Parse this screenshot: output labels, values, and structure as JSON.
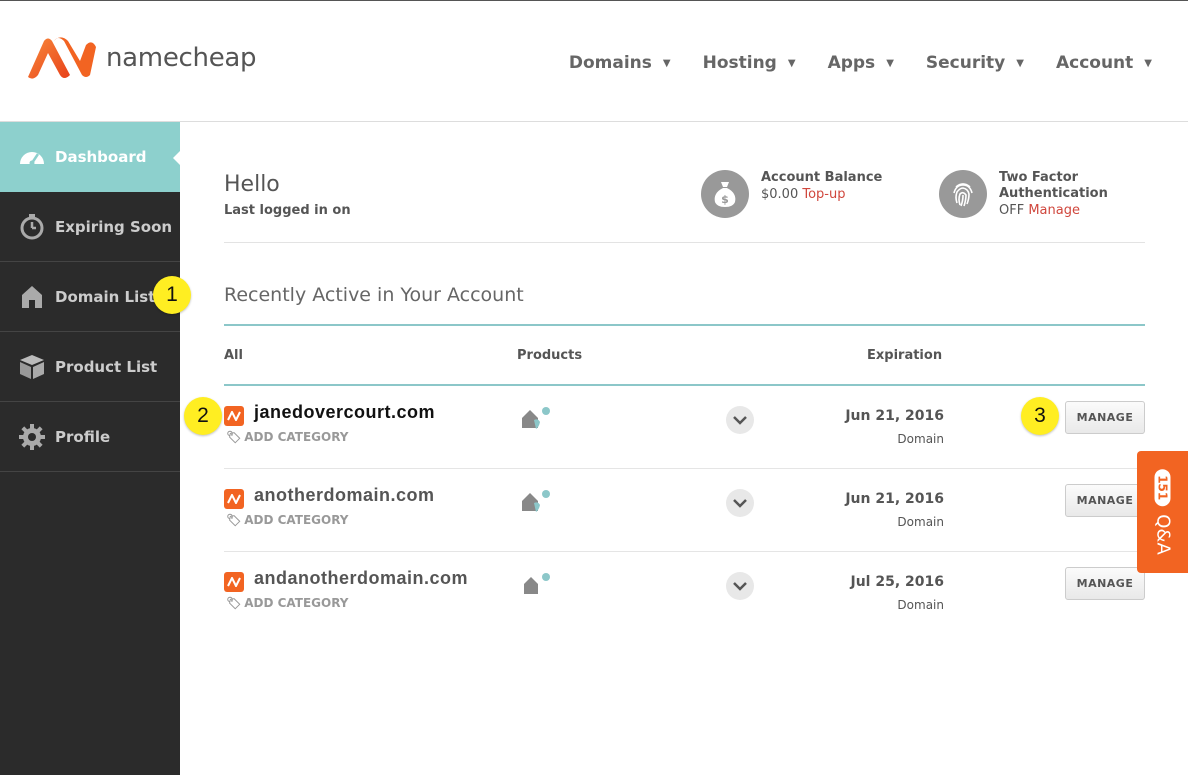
{
  "brand": {
    "name": "namecheap"
  },
  "nav": [
    {
      "label": "Domains"
    },
    {
      "label": "Hosting"
    },
    {
      "label": "Apps"
    },
    {
      "label": "Security"
    },
    {
      "label": "Account"
    }
  ],
  "sidebar": {
    "items": [
      {
        "label": "Dashboard",
        "icon": "speedometer-icon",
        "active": true
      },
      {
        "label": "Expiring Soon",
        "icon": "timer-icon"
      },
      {
        "label": "Domain List",
        "icon": "house-icon"
      },
      {
        "label": "Product List",
        "icon": "box-icon"
      },
      {
        "label": "Profile",
        "icon": "gear-icon"
      }
    ]
  },
  "badges": [
    "1",
    "2",
    "3"
  ],
  "greeting": {
    "hello": "Hello",
    "last_logged": "Last logged in on"
  },
  "balance": {
    "title": "Account Balance",
    "amount": "$0.00",
    "link": "Top-up"
  },
  "twofactor": {
    "title_line1": "Two Factor",
    "title_line2": "Authentication",
    "status": "OFF",
    "link": "Manage"
  },
  "recent": {
    "title": "Recently Active in Your Account",
    "columns": {
      "all": "All",
      "products": "Products",
      "expiration": "Expiration"
    },
    "rows": [
      {
        "domain": "janedovercourt.com",
        "add_category": "ADD CATEGORY",
        "date": "Jun 21, 2016",
        "type": "Domain",
        "manage": "MANAGE"
      },
      {
        "domain": "anotherdomain.com",
        "add_category": "ADD CATEGORY",
        "date": "Jun 21, 2016",
        "type": "Domain",
        "manage": "MANAGE"
      },
      {
        "domain": "andanotherdomain.com",
        "add_category": "ADD CATEGORY",
        "date": "Jul 25, 2016",
        "type": "Domain",
        "manage": "MANAGE"
      }
    ]
  },
  "qa": {
    "label": "Q&A",
    "count": "151"
  },
  "colors": {
    "brand_orange": "#f26422",
    "teal": "#8dd0cd",
    "sidebar": "#2b2b2b",
    "link_red": "#d0473d",
    "badge_yellow": "#ffee22"
  }
}
